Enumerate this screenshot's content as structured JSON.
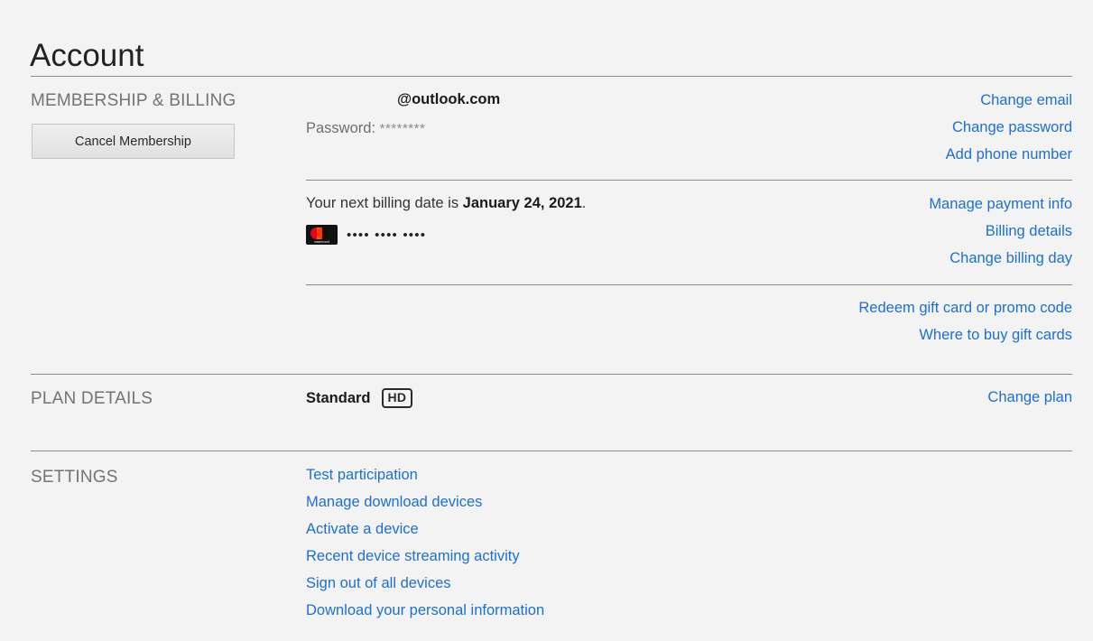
{
  "page": {
    "title": "Account",
    "background_color": "#f3f3f3",
    "link_color": "#1f6fd0",
    "label_color": "#737373"
  },
  "membership": {
    "section_label": "MEMBERSHIP & BILLING",
    "cancel_button": "Cancel Membership",
    "email": "@outlook.com",
    "password_label": "Password:",
    "password_mask": "********",
    "links": [
      {
        "label": "Change email"
      },
      {
        "label": "Change password"
      },
      {
        "label": "Add phone number"
      }
    ]
  },
  "billing": {
    "next_billing_prefix": "Your next billing date is ",
    "next_billing_date": "January 24, 2021",
    "next_billing_suffix": ".",
    "card_brand": "mastercard",
    "card_brand_text": "mastercard",
    "card_number_masked": "•••• •••• ••••",
    "links": [
      {
        "label": "Manage payment info"
      },
      {
        "label": "Billing details"
      },
      {
        "label": "Change billing day"
      }
    ]
  },
  "gift": {
    "links": [
      {
        "label": "Redeem gift card or promo code"
      },
      {
        "label": "Where to buy gift cards"
      }
    ]
  },
  "plan": {
    "section_label": "PLAN DETAILS",
    "plan_name": "Standard",
    "quality_badge": "HD",
    "change_link": "Change plan"
  },
  "settings": {
    "section_label": "SETTINGS",
    "links": [
      {
        "label": "Test participation"
      },
      {
        "label": "Manage download devices"
      },
      {
        "label": "Activate a device"
      },
      {
        "label": "Recent device streaming activity"
      },
      {
        "label": "Sign out of all devices"
      },
      {
        "label": "Download your personal information"
      }
    ]
  }
}
